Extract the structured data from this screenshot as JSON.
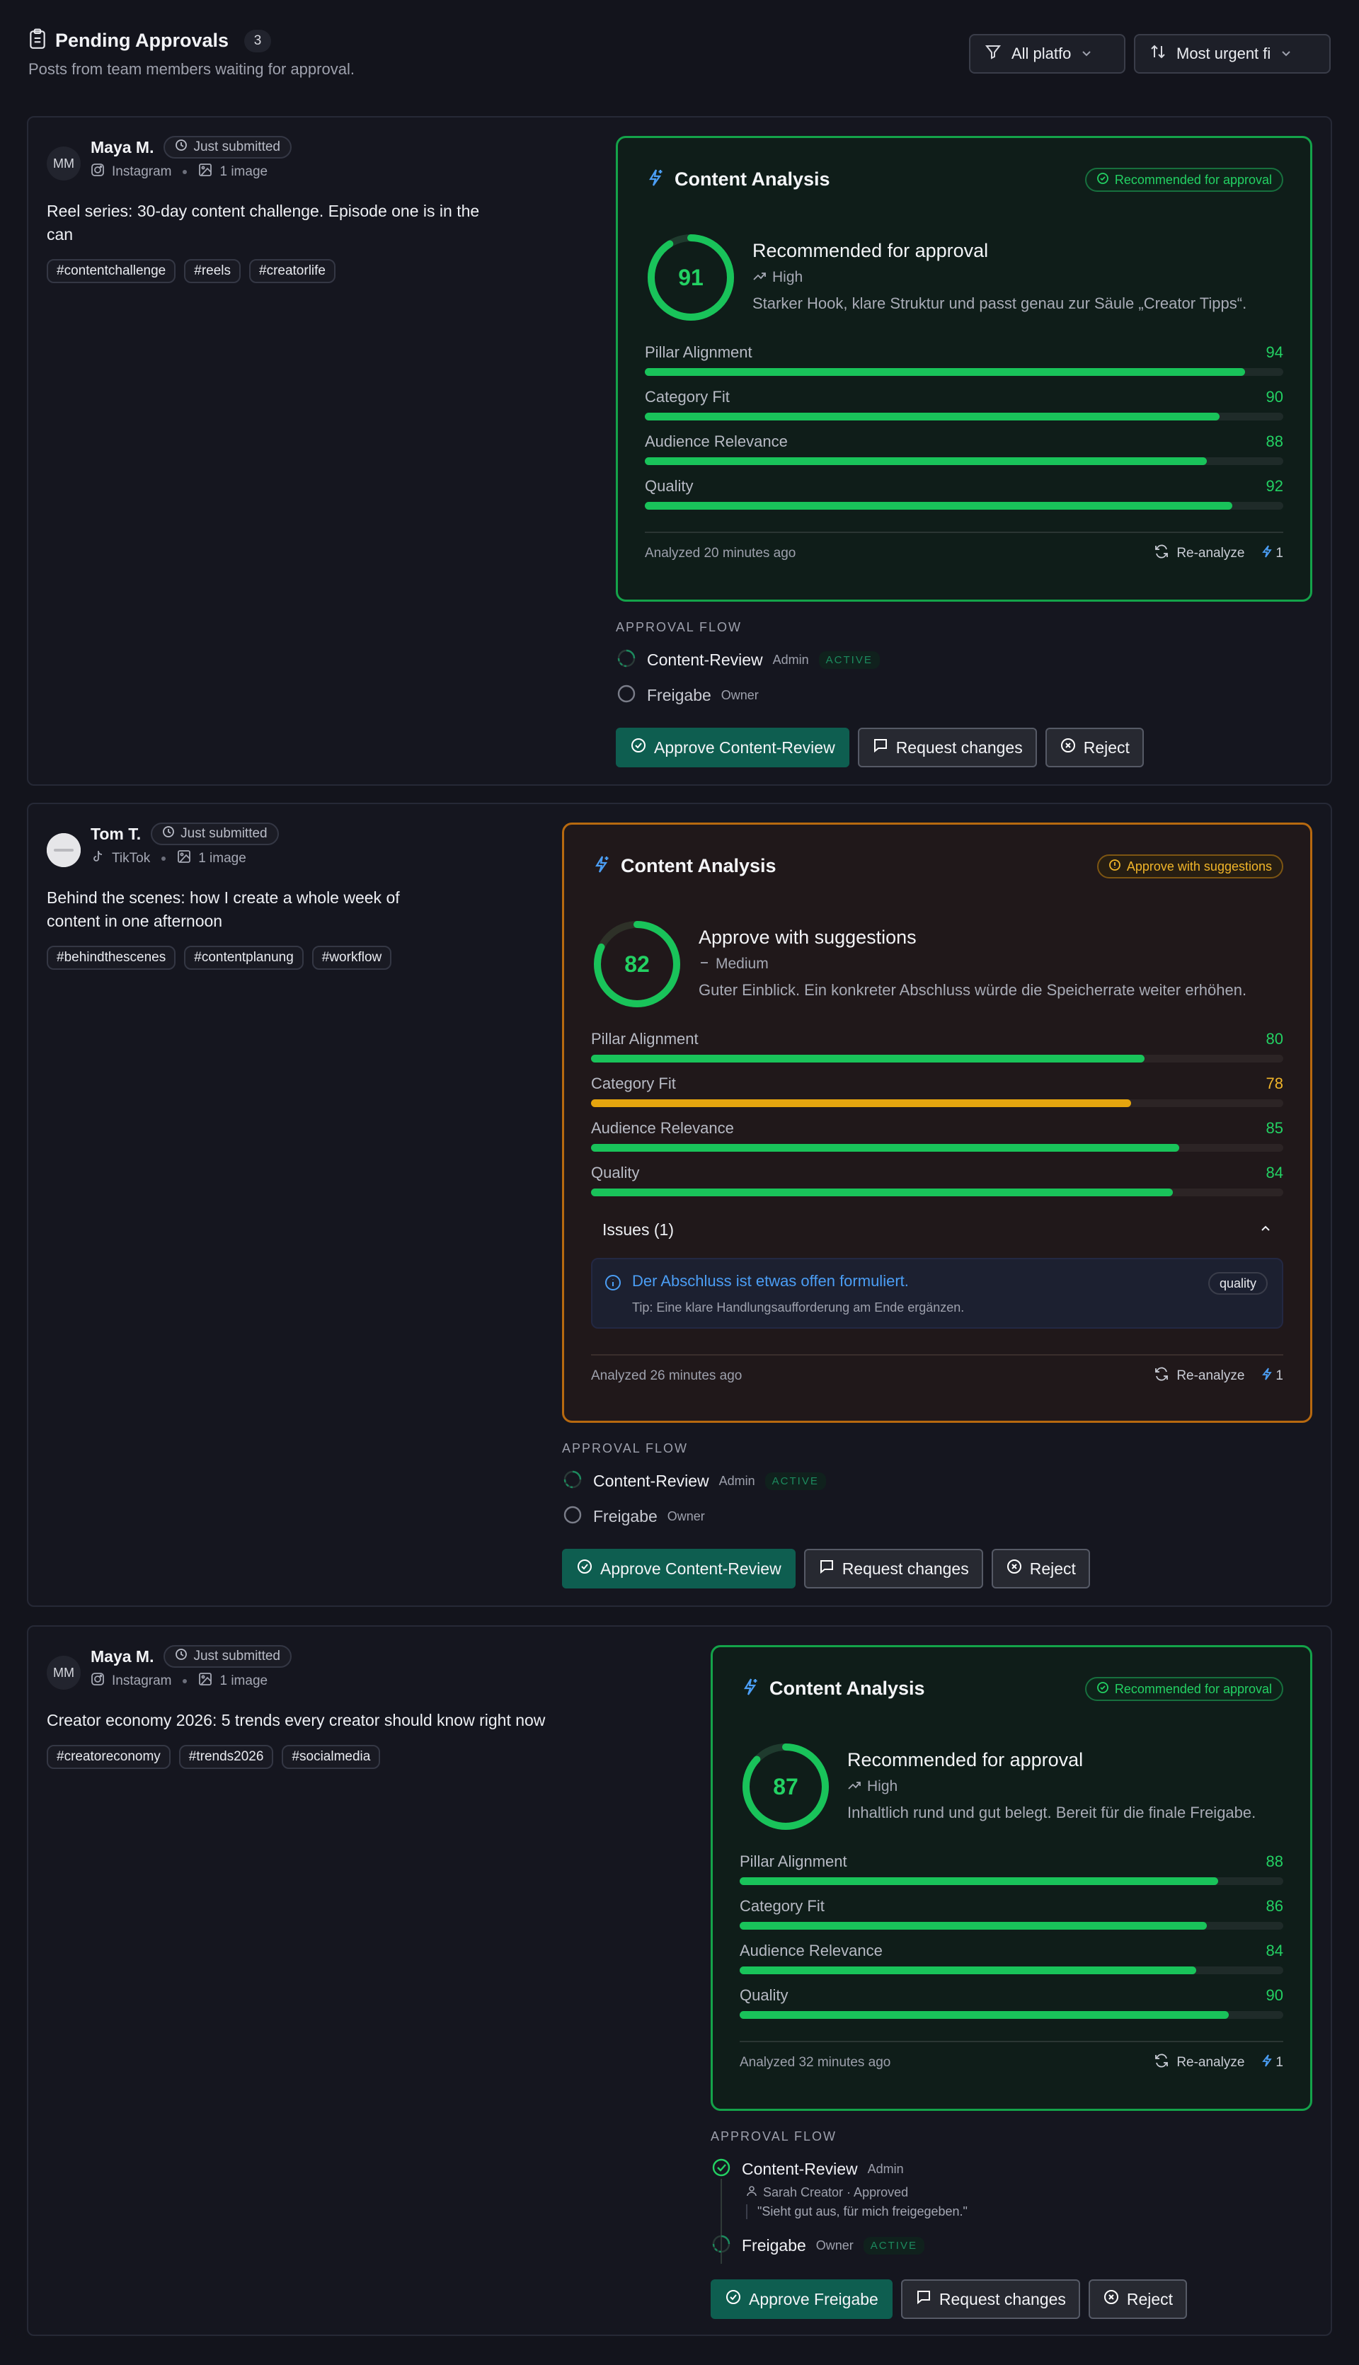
{
  "header": {
    "title": "Pending Approvals",
    "count": "3",
    "subtitle": "Posts from team members waiting for approval.",
    "platform_filter": "All platfo",
    "sort_filter": "Most urgent fi"
  },
  "labels": {
    "analysis_title": "Content Analysis",
    "re_analyze": "Re-analyze",
    "approval_flow": "APPROVAL FLOW",
    "active": "ACTIVE",
    "request_changes": "Request changes",
    "reject": "Reject",
    "just_submitted": "Just submitted"
  },
  "colors": {
    "green": "#19c35a",
    "amber": "#e5a50e",
    "blue": "#4b9ef5",
    "primary_button": "#0e5e50"
  },
  "posts": [
    {
      "author": "Maya M.",
      "avatar": "MM",
      "status": "Just submitted",
      "platform": "Instagram",
      "platform_icon": "instagram-icon",
      "media": "1 image",
      "text": "Reel series: 30-day content challenge. Episode one is in the can",
      "tags": [
        "#contentchallenge",
        "#reels",
        "#creatorlife"
      ],
      "analysis": {
        "badge": "Recommended for approval",
        "score": 91,
        "verdict": "Recommended for approval",
        "level": "High",
        "description": "Starker Hook, klare Struktur und passt genau zur Säule „Creator Tipps“.",
        "metrics": [
          {
            "name": "Pillar Alignment",
            "value": 94
          },
          {
            "name": "Category Fit",
            "value": 90
          },
          {
            "name": "Audience Relevance",
            "value": 88
          },
          {
            "name": "Quality",
            "value": 92
          }
        ],
        "analyzed": "Analyzed 20 minutes ago",
        "credits": "1"
      },
      "flow": [
        {
          "name": "Content-Review",
          "role": "Admin",
          "state": "ACTIVE"
        },
        {
          "name": "Freigabe",
          "role": "Owner",
          "state": ""
        }
      ],
      "approve_label": "Approve Content-Review"
    },
    {
      "author": "Tom T.",
      "avatar": "tom-avatar",
      "status": "Just submitted",
      "platform": "TikTok",
      "platform_icon": "tiktok-icon",
      "media": "1 image",
      "text": "Behind the scenes: how I create a whole week of content in one afternoon",
      "tags": [
        "#behindthescenes",
        "#contentplanung",
        "#workflow"
      ],
      "analysis": {
        "badge": "Approve with suggestions",
        "score": 82,
        "verdict": "Approve with suggestions",
        "level": "Medium",
        "description": "Guter Einblick. Ein konkreter Abschluss würde die Speicherrate weiter erhöhen.",
        "metrics": [
          {
            "name": "Pillar Alignment",
            "value": 80
          },
          {
            "name": "Category Fit",
            "value": 78
          },
          {
            "name": "Audience Relevance",
            "value": 85
          },
          {
            "name": "Quality",
            "value": 84
          }
        ],
        "issues_label": "Issues (1)",
        "issue": {
          "title": "Der Abschluss ist etwas offen formuliert.",
          "tip": "Tip: Eine klare Handlungsaufforderung am Ende ergänzen.",
          "tag": "quality"
        },
        "analyzed": "Analyzed 26 minutes ago",
        "credits": "1"
      },
      "flow": [
        {
          "name": "Content-Review",
          "role": "Admin",
          "state": "ACTIVE"
        },
        {
          "name": "Freigabe",
          "role": "Owner",
          "state": ""
        }
      ],
      "approve_label": "Approve Content-Review"
    },
    {
      "author": "Maya M.",
      "avatar": "MM",
      "status": "Just submitted",
      "platform": "Instagram",
      "platform_icon": "instagram-icon",
      "media": "1 image",
      "text": "Creator economy 2026: 5 trends every creator should know right now",
      "tags": [
        "#creatoreconomy",
        "#trends2026",
        "#socialmedia"
      ],
      "analysis": {
        "badge": "Recommended for approval",
        "score": 87,
        "verdict": "Recommended for approval",
        "level": "High",
        "description": "Inhaltlich rund und gut belegt. Bereit für die finale Freigabe.",
        "metrics": [
          {
            "name": "Pillar Alignment",
            "value": 88
          },
          {
            "name": "Category Fit",
            "value": 86
          },
          {
            "name": "Audience Relevance",
            "value": 84
          },
          {
            "name": "Quality",
            "value": 90
          }
        ],
        "analyzed": "Analyzed 32 minutes ago",
        "credits": "1"
      },
      "flow": [
        {
          "name": "Content-Review",
          "role": "Admin",
          "state": "APPROVED",
          "approver": "Sarah Creator · Approved",
          "comment": "\"Sieht gut aus, für mich freigegeben.\""
        },
        {
          "name": "Freigabe",
          "role": "Owner",
          "state": "ACTIVE"
        }
      ],
      "approve_label": "Approve Freigabe"
    }
  ]
}
